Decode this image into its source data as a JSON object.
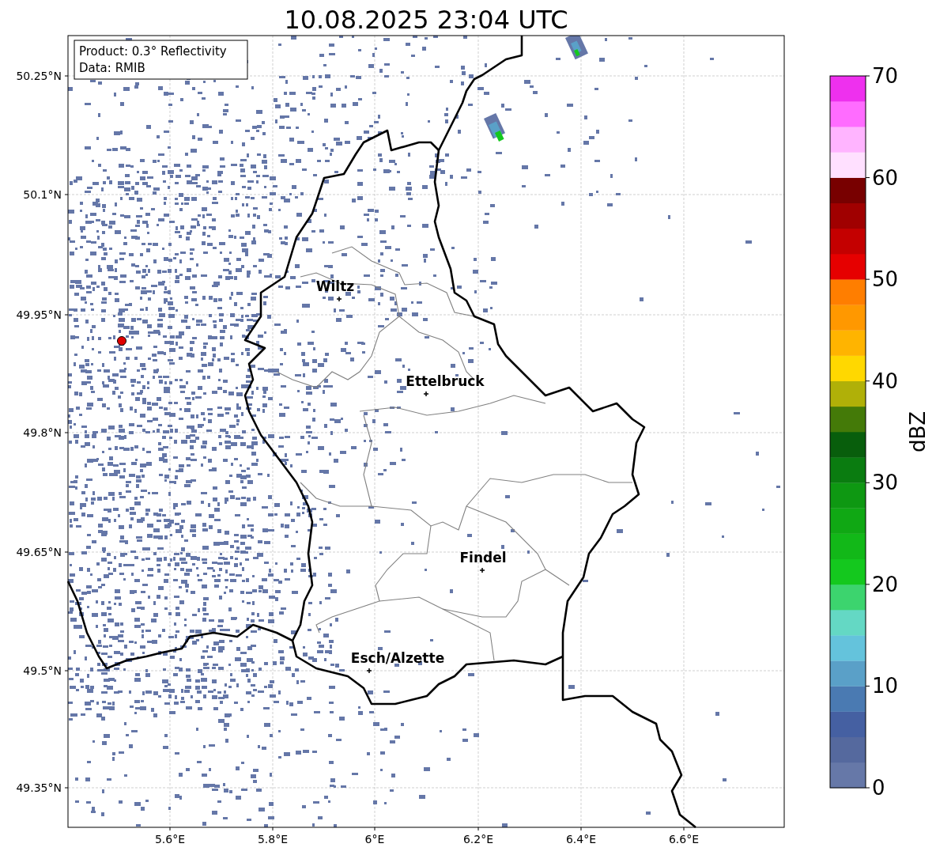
{
  "title": "10.08.2025 23:04 UTC",
  "info_box": {
    "lines": [
      "Product: 0.3° Reflectivity",
      "Data: RMIB"
    ]
  },
  "map": {
    "y_ticks": [
      "50.25°N",
      "50.1°N",
      "49.95°N",
      "49.8°N",
      "49.65°N",
      "49.5°N",
      "49.35°N"
    ],
    "x_ticks": [
      "5.6°E",
      "5.8°E",
      "6°E",
      "6.2°E",
      "6.4°E",
      "6.6°E"
    ],
    "cities": [
      {
        "name": "Wiltz"
      },
      {
        "name": "Ettelbruck"
      },
      {
        "name": "Findel"
      },
      {
        "name": "Esch/Alzette"
      }
    ]
  },
  "colorbar": {
    "label": "dBZ",
    "ticks": [
      "70",
      "60",
      "50",
      "40",
      "30",
      "20",
      "10",
      "0"
    ],
    "bands": [
      {
        "color": "#6678a8"
      },
      {
        "color": "#55699e"
      },
      {
        "color": "#4560a2"
      },
      {
        "color": "#4a7ab2"
      },
      {
        "color": "#5aa0c8"
      },
      {
        "color": "#64c3dc"
      },
      {
        "color": "#64d8c4"
      },
      {
        "color": "#3cd46e"
      },
      {
        "color": "#14c81e"
      },
      {
        "color": "#12b818"
      },
      {
        "color": "#10a814"
      },
      {
        "color": "#0e9812"
      },
      {
        "color": "#0a7c10"
      },
      {
        "color": "#085e0c"
      },
      {
        "color": "#447a08"
      },
      {
        "color": "#b0b008"
      },
      {
        "color": "#ffd800"
      },
      {
        "color": "#ffb400"
      },
      {
        "color": "#ff9800"
      },
      {
        "color": "#ff7e00"
      },
      {
        "color": "#e60000"
      },
      {
        "color": "#c40000"
      },
      {
        "color": "#a00000"
      },
      {
        "color": "#780000"
      },
      {
        "color": "#ffe0ff"
      },
      {
        "color": "#ffb4ff"
      },
      {
        "color": "#ff6cff"
      },
      {
        "color": "#ee30ee"
      }
    ]
  }
}
